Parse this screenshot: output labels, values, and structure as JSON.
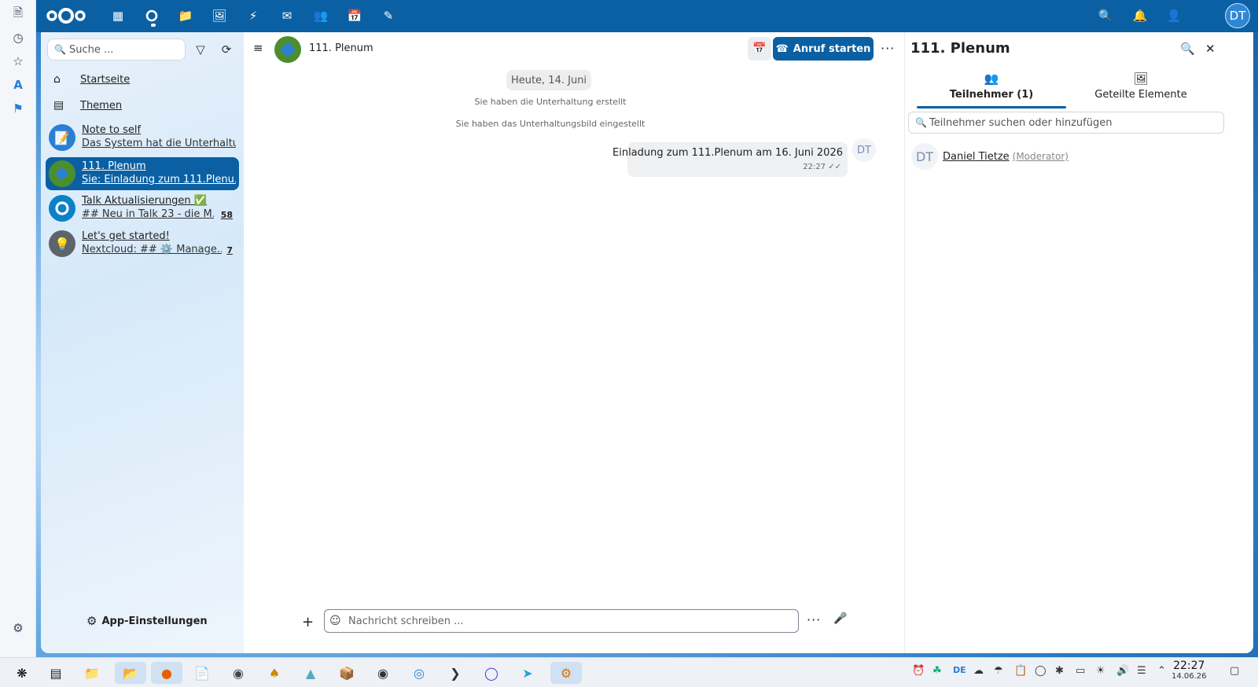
{
  "colors": {
    "primary": "#0a60a3",
    "sidebar_bg": "#dcecfa",
    "bubble": "#eef0f2"
  },
  "vdock": {
    "icons": [
      "notes-icon",
      "clock-icon",
      "star-icon",
      "translate-icon",
      "tag-icon"
    ],
    "settings_icon": "gear-icon"
  },
  "topbar": {
    "apps": [
      "dashboard-icon",
      "talk-icon",
      "files-icon",
      "photos-icon",
      "activity-icon",
      "mail-icon",
      "contacts-icon",
      "calendar-icon",
      "notes-edit-icon"
    ],
    "active_app": "talk-icon",
    "avatar_initials": "DT"
  },
  "sidebar": {
    "search_placeholder": "Suche ...",
    "nav": [
      {
        "label": "Startseite",
        "icon": "home-icon"
      },
      {
        "label": "Themen",
        "icon": "topics-icon"
      }
    ],
    "conversations": [
      {
        "title": "Note to self",
        "subtitle": "Das System hat die Unterhaltu...",
        "badge": "",
        "active": false
      },
      {
        "title": "111. Plenum",
        "subtitle": "Sie: Einladung zum 111.Plenu...",
        "badge": "",
        "active": true
      },
      {
        "title": "Talk Aktualisierungen ✅",
        "subtitle": "## Neu in Talk 23 - die M...",
        "badge": "58",
        "active": false
      },
      {
        "title": "Let's get started!",
        "subtitle": "Nextcloud: ## ⚙️ Manage...",
        "badge": "7",
        "active": false
      }
    ],
    "app_settings_label": "App-Einstellungen"
  },
  "chat": {
    "title": "111. Plenum",
    "call_button": "Anruf starten",
    "date_separator": "Heute, 14. Juni",
    "system_messages": [
      "Sie haben die Unterhaltung erstellt",
      "Sie haben das Unterhaltungsbild eingestellt"
    ],
    "message": {
      "text": "Einladung zum 111.Plenum am 16. Juni 2026",
      "time": "22:27",
      "author_initials": "DT"
    },
    "composer_placeholder": "Nachricht schreiben ..."
  },
  "rpanel": {
    "title": "111. Plenum",
    "tabs": [
      {
        "label": "Teilnehmer (1)",
        "icon": "participants-icon",
        "active": true
      },
      {
        "label": "Geteilte Elemente",
        "icon": "shared-items-icon",
        "active": false
      }
    ],
    "search_placeholder": "Teilnehmer suchen oder hinzufügen",
    "participant": {
      "initials": "DT",
      "name": "Daniel Tietze",
      "role": "(Moderator)"
    }
  },
  "taskbar": {
    "apps": [
      "launcher-icon",
      "terminal-window-icon",
      "file-manager-icon",
      "file-dialog-icon",
      "firefox-icon",
      "document-icon",
      "disk-icon",
      "cards-icon",
      "image-viewer-icon",
      "archive-icon",
      "spy-icon",
      "browser-icon",
      "console-icon",
      "nextcloud-talk-icon",
      "telegram-icon",
      "settings-app-icon"
    ],
    "active_apps": [
      "file-dialog-icon",
      "firefox-icon",
      "settings-app-icon"
    ],
    "tray_lang": "DE",
    "clock_time": "22:27",
    "clock_date": "14.06.26"
  }
}
